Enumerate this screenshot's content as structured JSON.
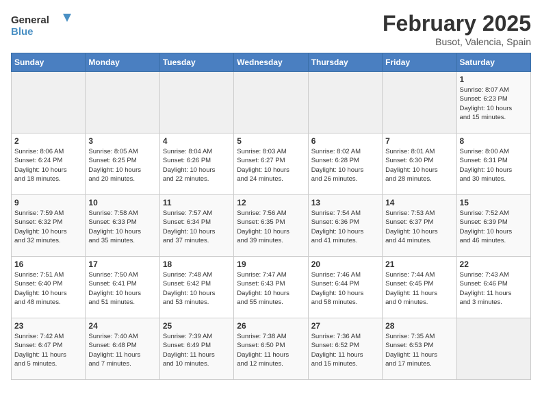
{
  "header": {
    "logo_general": "General",
    "logo_blue": "Blue",
    "month_title": "February 2025",
    "subtitle": "Busot, Valencia, Spain"
  },
  "days_of_week": [
    "Sunday",
    "Monday",
    "Tuesday",
    "Wednesday",
    "Thursday",
    "Friday",
    "Saturday"
  ],
  "weeks": [
    [
      {
        "day": "",
        "info": ""
      },
      {
        "day": "",
        "info": ""
      },
      {
        "day": "",
        "info": ""
      },
      {
        "day": "",
        "info": ""
      },
      {
        "day": "",
        "info": ""
      },
      {
        "day": "",
        "info": ""
      },
      {
        "day": "1",
        "info": "Sunrise: 8:07 AM\nSunset: 6:23 PM\nDaylight: 10 hours\nand 15 minutes."
      }
    ],
    [
      {
        "day": "2",
        "info": "Sunrise: 8:06 AM\nSunset: 6:24 PM\nDaylight: 10 hours\nand 18 minutes."
      },
      {
        "day": "3",
        "info": "Sunrise: 8:05 AM\nSunset: 6:25 PM\nDaylight: 10 hours\nand 20 minutes."
      },
      {
        "day": "4",
        "info": "Sunrise: 8:04 AM\nSunset: 6:26 PM\nDaylight: 10 hours\nand 22 minutes."
      },
      {
        "day": "5",
        "info": "Sunrise: 8:03 AM\nSunset: 6:27 PM\nDaylight: 10 hours\nand 24 minutes."
      },
      {
        "day": "6",
        "info": "Sunrise: 8:02 AM\nSunset: 6:28 PM\nDaylight: 10 hours\nand 26 minutes."
      },
      {
        "day": "7",
        "info": "Sunrise: 8:01 AM\nSunset: 6:30 PM\nDaylight: 10 hours\nand 28 minutes."
      },
      {
        "day": "8",
        "info": "Sunrise: 8:00 AM\nSunset: 6:31 PM\nDaylight: 10 hours\nand 30 minutes."
      }
    ],
    [
      {
        "day": "9",
        "info": "Sunrise: 7:59 AM\nSunset: 6:32 PM\nDaylight: 10 hours\nand 32 minutes."
      },
      {
        "day": "10",
        "info": "Sunrise: 7:58 AM\nSunset: 6:33 PM\nDaylight: 10 hours\nand 35 minutes."
      },
      {
        "day": "11",
        "info": "Sunrise: 7:57 AM\nSunset: 6:34 PM\nDaylight: 10 hours\nand 37 minutes."
      },
      {
        "day": "12",
        "info": "Sunrise: 7:56 AM\nSunset: 6:35 PM\nDaylight: 10 hours\nand 39 minutes."
      },
      {
        "day": "13",
        "info": "Sunrise: 7:54 AM\nSunset: 6:36 PM\nDaylight: 10 hours\nand 41 minutes."
      },
      {
        "day": "14",
        "info": "Sunrise: 7:53 AM\nSunset: 6:37 PM\nDaylight: 10 hours\nand 44 minutes."
      },
      {
        "day": "15",
        "info": "Sunrise: 7:52 AM\nSunset: 6:39 PM\nDaylight: 10 hours\nand 46 minutes."
      }
    ],
    [
      {
        "day": "16",
        "info": "Sunrise: 7:51 AM\nSunset: 6:40 PM\nDaylight: 10 hours\nand 48 minutes."
      },
      {
        "day": "17",
        "info": "Sunrise: 7:50 AM\nSunset: 6:41 PM\nDaylight: 10 hours\nand 51 minutes."
      },
      {
        "day": "18",
        "info": "Sunrise: 7:48 AM\nSunset: 6:42 PM\nDaylight: 10 hours\nand 53 minutes."
      },
      {
        "day": "19",
        "info": "Sunrise: 7:47 AM\nSunset: 6:43 PM\nDaylight: 10 hours\nand 55 minutes."
      },
      {
        "day": "20",
        "info": "Sunrise: 7:46 AM\nSunset: 6:44 PM\nDaylight: 10 hours\nand 58 minutes."
      },
      {
        "day": "21",
        "info": "Sunrise: 7:44 AM\nSunset: 6:45 PM\nDaylight: 11 hours\nand 0 minutes."
      },
      {
        "day": "22",
        "info": "Sunrise: 7:43 AM\nSunset: 6:46 PM\nDaylight: 11 hours\nand 3 minutes."
      }
    ],
    [
      {
        "day": "23",
        "info": "Sunrise: 7:42 AM\nSunset: 6:47 PM\nDaylight: 11 hours\nand 5 minutes."
      },
      {
        "day": "24",
        "info": "Sunrise: 7:40 AM\nSunset: 6:48 PM\nDaylight: 11 hours\nand 7 minutes."
      },
      {
        "day": "25",
        "info": "Sunrise: 7:39 AM\nSunset: 6:49 PM\nDaylight: 11 hours\nand 10 minutes."
      },
      {
        "day": "26",
        "info": "Sunrise: 7:38 AM\nSunset: 6:50 PM\nDaylight: 11 hours\nand 12 minutes."
      },
      {
        "day": "27",
        "info": "Sunrise: 7:36 AM\nSunset: 6:52 PM\nDaylight: 11 hours\nand 15 minutes."
      },
      {
        "day": "28",
        "info": "Sunrise: 7:35 AM\nSunset: 6:53 PM\nDaylight: 11 hours\nand 17 minutes."
      },
      {
        "day": "",
        "info": ""
      }
    ]
  ]
}
